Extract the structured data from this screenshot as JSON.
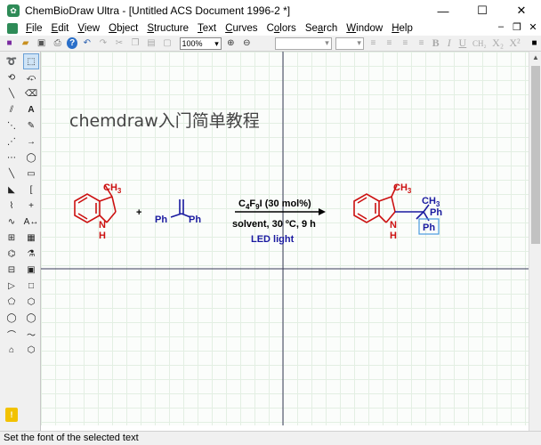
{
  "window": {
    "app_icon": "chemdraw-app-icon",
    "title": "ChemBioDraw Ultra - [Untitled ACS Document 1996-2 *]",
    "minimize": "—",
    "maximize": "☐",
    "close": "✕"
  },
  "menu": {
    "items": [
      {
        "label": "File",
        "underline": "F",
        "rest": "ile"
      },
      {
        "label": "Edit",
        "underline": "E",
        "rest": "dit"
      },
      {
        "label": "View",
        "underline": "V",
        "rest": "iew"
      },
      {
        "label": "Object",
        "underline": "O",
        "rest": "bject"
      },
      {
        "label": "Structure",
        "underline": "S",
        "rest": "tructure"
      },
      {
        "label": "Text",
        "underline": "T",
        "rest": "ext"
      },
      {
        "label": "Curves",
        "underline": "C",
        "rest": "urves"
      },
      {
        "label": "Colors",
        "underline": "o",
        "rest": "lors"
      },
      {
        "label": "Search",
        "underline": "a",
        "rest": "rch"
      },
      {
        "label": "Window",
        "underline": "W",
        "rest": "indow"
      },
      {
        "label": "Help",
        "underline": "H",
        "rest": "elp"
      }
    ]
  },
  "toolbar": {
    "zoom": "100%",
    "format_buttons": [
      "B",
      "I",
      "U",
      "CH₂",
      "X₂",
      "X²"
    ]
  },
  "canvas": {
    "heading": "chemdraw入门简单教程",
    "scheme": {
      "reactant1": {
        "methyl": "CH",
        "methyl_sub": "3",
        "nh_n": "N",
        "nh_h": "H"
      },
      "plus": "+",
      "reactant2": {
        "ph_left": "Ph",
        "ph_right": "Ph"
      },
      "arrow": {
        "catalyst_main": "C",
        "catalyst_sub1": "4",
        "catalyst_mid": "F",
        "catalyst_sub2": "9",
        "catalyst_rest": "I (30 mol%)",
        "conditions": "solvent, 30 ºC, 9 h",
        "light": "LED light"
      },
      "product": {
        "methyl": "CH",
        "methyl_sub": "3",
        "quat_methyl": "CH",
        "quat_methyl_sub": "3",
        "ph_top": "Ph",
        "ph_selected": "Ph",
        "nh_n": "N",
        "nh_h": "H"
      }
    }
  },
  "status": {
    "text": "Set the font of the selected text"
  },
  "colors": {
    "reactant": "#cc1111",
    "reagent": "#1a1aa0",
    "light_label": "#1a1aa0",
    "heading": "#444444",
    "guide_lines": "#3a3a5a",
    "selection_box": "#4a9be0"
  }
}
